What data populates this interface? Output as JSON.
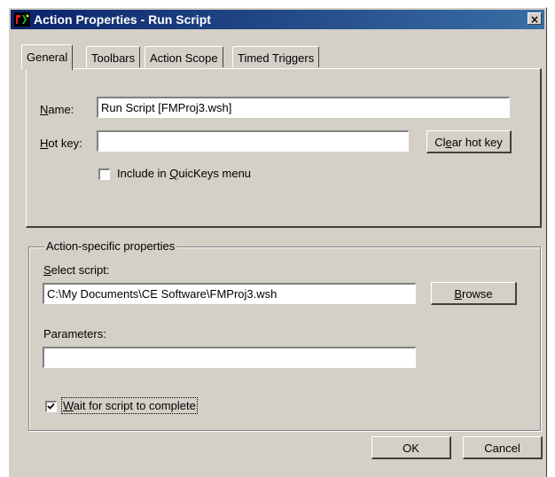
{
  "window": {
    "title": "Action Properties - Run Script",
    "close_glyph": "×"
  },
  "tabs": [
    {
      "label": "General"
    },
    {
      "label": "Toolbars"
    },
    {
      "label": "Action Scope"
    },
    {
      "label": "Timed Triggers"
    }
  ],
  "general": {
    "name_label_key": "N",
    "name_label_rest": "ame:",
    "name_value": "Run Script [FMProj3.wsh]",
    "hotkey_label_key": "H",
    "hotkey_label_rest": "ot key:",
    "hotkey_value": "",
    "clear_hotkey_pre": "Cl",
    "clear_hotkey_key": "e",
    "clear_hotkey_post": "ar hot key",
    "quickeys_pre": "Include in ",
    "quickeys_key": "Q",
    "quickeys_post": "uicKeys menu",
    "quickeys_checked": false
  },
  "action_specific": {
    "group_label": "Action-specific properties",
    "select_script_key": "S",
    "select_script_rest": "elect script:",
    "script_path": "C:\\My Documents\\CE Software\\FMProj3.wsh",
    "browse_key": "B",
    "browse_rest": "rowse",
    "parameters_label": "Parameters:",
    "parameters_value": "",
    "wait_key": "W",
    "wait_rest": "ait for script to complete",
    "wait_checked": true
  },
  "footer": {
    "ok_label": "OK",
    "cancel_label": "Cancel"
  }
}
